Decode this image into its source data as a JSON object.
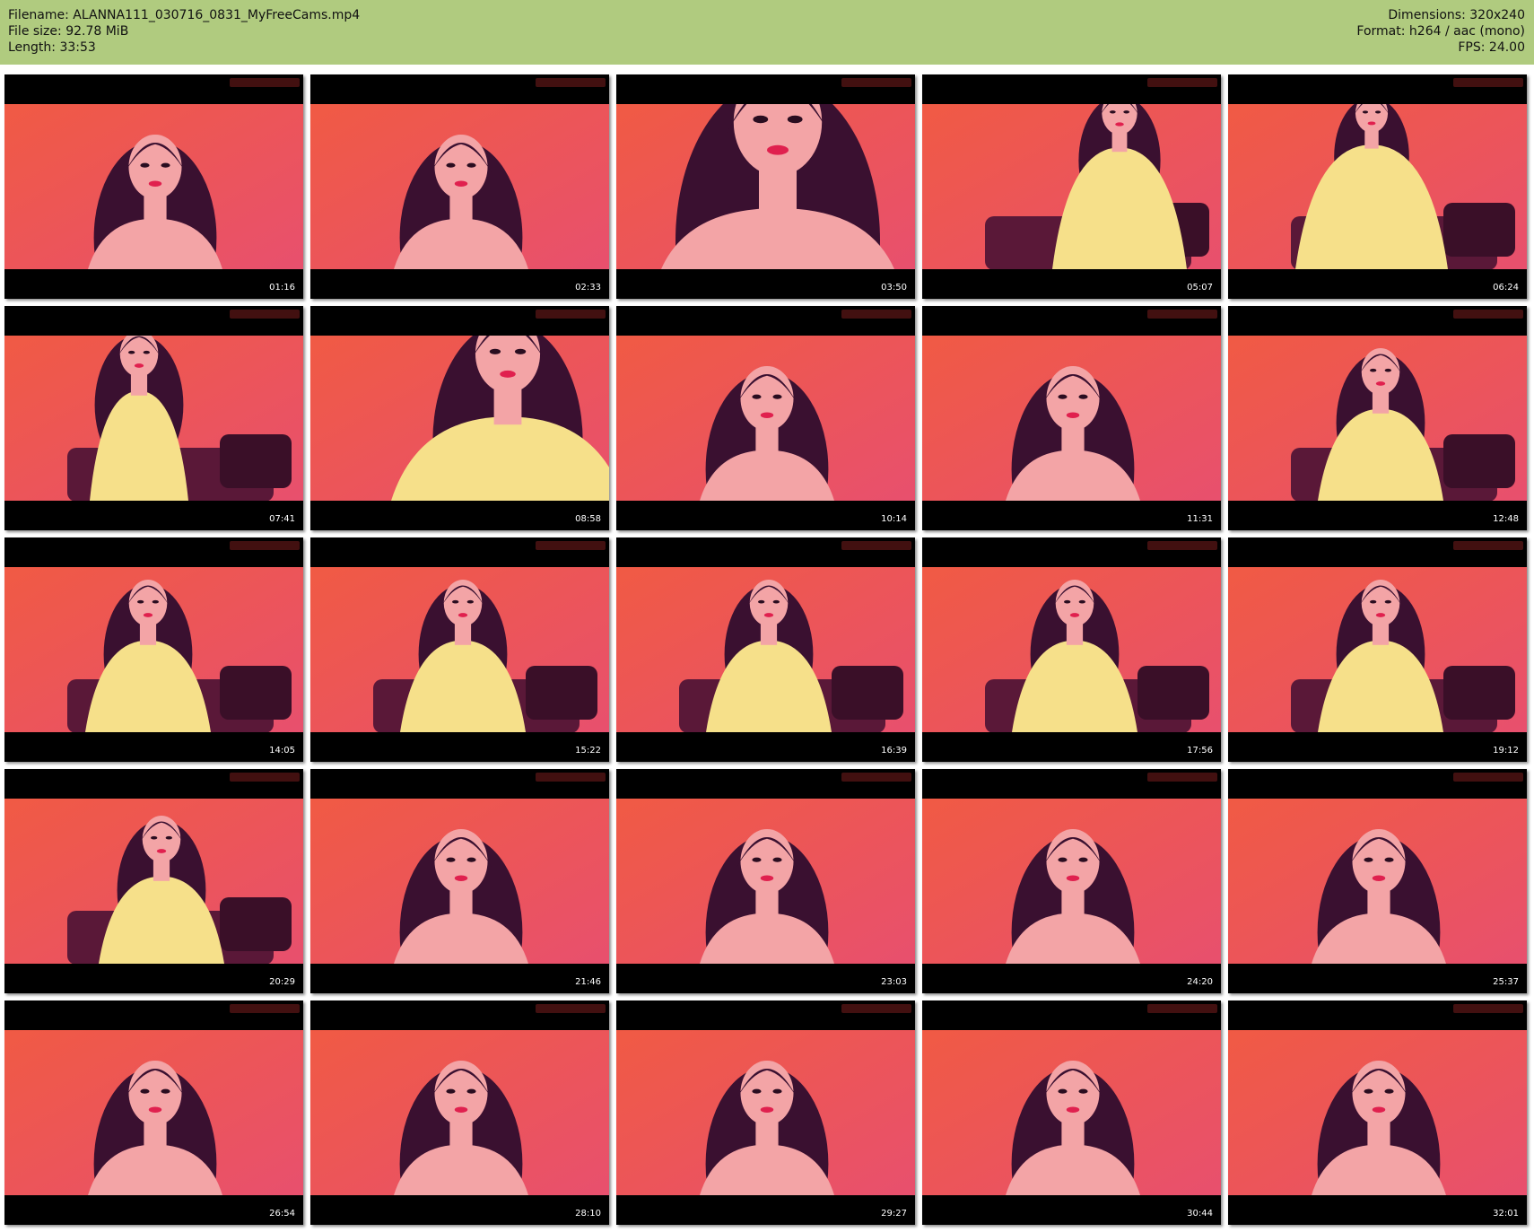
{
  "header": {
    "filename_line": "Filename: ALANNA111_030716_0831_MyFreeCams.mp4",
    "filesize_line": "File size: 92.78 MiB",
    "length_line": "Length: 33:53",
    "dimensions_line": "Dimensions: 320x240",
    "format_line": "Format: h264 / aac (mono)",
    "fps_line": "FPS: 24.00"
  },
  "thumbnails": [
    {
      "time": "01:16"
    },
    {
      "time": "02:33"
    },
    {
      "time": "03:50"
    },
    {
      "time": "05:07"
    },
    {
      "time": "06:24"
    },
    {
      "time": "07:41"
    },
    {
      "time": "08:58"
    },
    {
      "time": "10:14"
    },
    {
      "time": "11:31"
    },
    {
      "time": "12:48"
    },
    {
      "time": "14:05"
    },
    {
      "time": "15:22"
    },
    {
      "time": "16:39"
    },
    {
      "time": "17:56"
    },
    {
      "time": "19:12"
    },
    {
      "time": "20:29"
    },
    {
      "time": "21:46"
    },
    {
      "time": "23:03"
    },
    {
      "time": "24:20"
    },
    {
      "time": "25:37"
    },
    {
      "time": "26:54"
    },
    {
      "time": "28:10"
    },
    {
      "time": "29:27"
    },
    {
      "time": "30:44"
    },
    {
      "time": "32:01"
    }
  ],
  "colors": {
    "header_bg": "#b0cb7f",
    "frame_bg": "#000000",
    "scene_bg": "#f05a44",
    "hair": "#3a1030",
    "skin": "#f3a4a6",
    "top": "#f6e08a"
  }
}
